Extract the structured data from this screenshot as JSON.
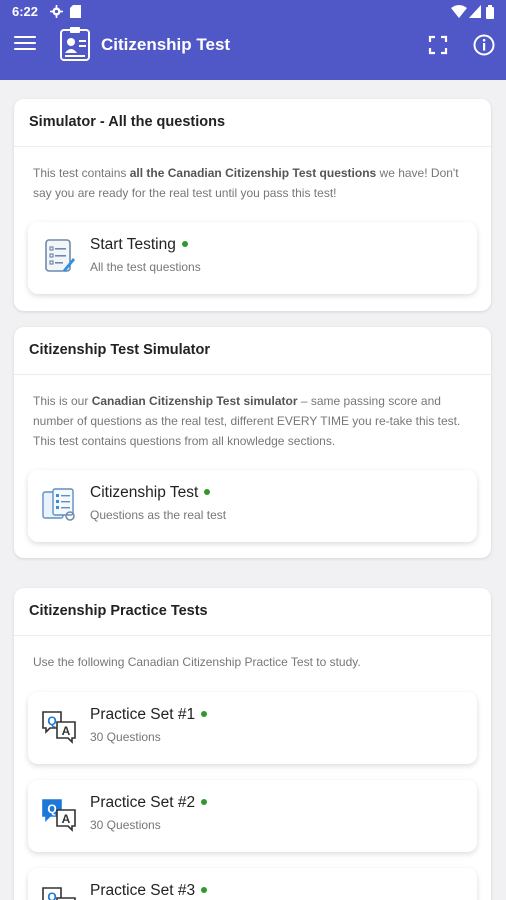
{
  "status": {
    "time": "6:22"
  },
  "appbar": {
    "title": "Citizenship Test"
  },
  "card1": {
    "title": "Simulator - All the questions",
    "desc_pre": "This test contains ",
    "desc_bold": "all the Canadian Citizenship Test questions",
    "desc_post": " we have! Don't say you are ready for the real test until you pass this test!",
    "item": {
      "title": "Start Testing",
      "subtitle": "All the test questions"
    }
  },
  "card2": {
    "title": "Citizenship Test Simulator",
    "desc_pre": "This is our ",
    "desc_bold": "Canadian Citizenship Test simulator",
    "desc_post": " – same passing score and number of questions as the real test, different EVERY TIME you re-take this test. This test contains questions from all knowledge sections.",
    "item": {
      "title": "Citizenship Test",
      "subtitle": "Questions as the real test"
    }
  },
  "card3": {
    "title": "Citizenship Practice Tests",
    "desc": "Use the following Canadian Citizenship Practice Test to study.",
    "items": [
      {
        "title": "Practice Set #1",
        "subtitle": "30 Questions"
      },
      {
        "title": "Practice Set #2",
        "subtitle": "30 Questions"
      },
      {
        "title": "Practice Set #3",
        "subtitle": ""
      }
    ]
  },
  "colors": {
    "primary": "#5058c8",
    "online_dot": "#2e9a2e",
    "qa_blue": "#1e78d8"
  },
  "icons": [
    "menu-icon",
    "id-card-logo-icon",
    "fullscreen-icon",
    "info-icon",
    "checklist-icon",
    "documents-icon",
    "qa-bubble-icon",
    "settings-icon",
    "sd-card-icon",
    "wifi-icon",
    "battery-icon"
  ]
}
